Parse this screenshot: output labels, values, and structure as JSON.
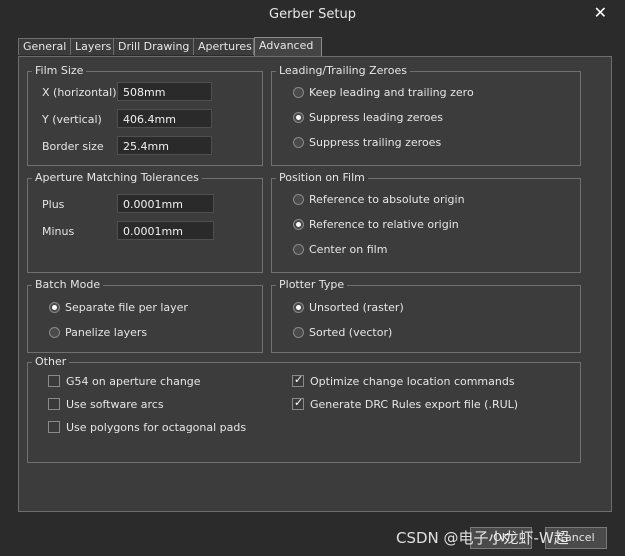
{
  "window": {
    "title": "Gerber Setup",
    "close_glyph": "✕"
  },
  "tabs": [
    "General",
    "Layers",
    "Drill Drawing",
    "Apertures",
    "Advanced"
  ],
  "film_size": {
    "label": "Film Size",
    "x_label": "X (horizontal)",
    "x_value": "508mm",
    "y_label": "Y (vertical)",
    "y_value": "406.4mm",
    "border_label": "Border size",
    "border_value": "25.4mm"
  },
  "leading": {
    "label": "Leading/Trailing Zeroes",
    "options": [
      "Keep leading and trailing zero",
      "Suppress leading zeroes",
      "Suppress trailing zeroes"
    ],
    "selected": 1
  },
  "aperture": {
    "label": "Aperture Matching Tolerances",
    "plus_label": "Plus",
    "plus_value": "0.0001mm",
    "minus_label": "Minus",
    "minus_value": "0.0001mm"
  },
  "position": {
    "label": "Position on Film",
    "options": [
      "Reference to absolute origin",
      "Reference to relative origin",
      "Center on film"
    ],
    "selected": 1
  },
  "batch": {
    "label": "Batch Mode",
    "options": [
      "Separate file per layer",
      "Panelize layers"
    ],
    "selected": 0
  },
  "plotter": {
    "label": "Plotter Type",
    "options": [
      "Unsorted (raster)",
      "Sorted (vector)"
    ],
    "selected": 0
  },
  "other": {
    "label": "Other",
    "left": [
      {
        "label": "G54 on aperture change",
        "checked": false
      },
      {
        "label": "Use software arcs",
        "checked": false
      },
      {
        "label": "Use polygons for octagonal pads",
        "checked": false
      }
    ],
    "right": [
      {
        "label": "Optimize change location commands",
        "checked": true
      },
      {
        "label": "Generate DRC Rules export file (.RUL)",
        "checked": true
      }
    ]
  },
  "buttons": {
    "ok": "OK",
    "cancel": "Cancel"
  },
  "watermark": "CSDN @电子小龙虾-W超"
}
